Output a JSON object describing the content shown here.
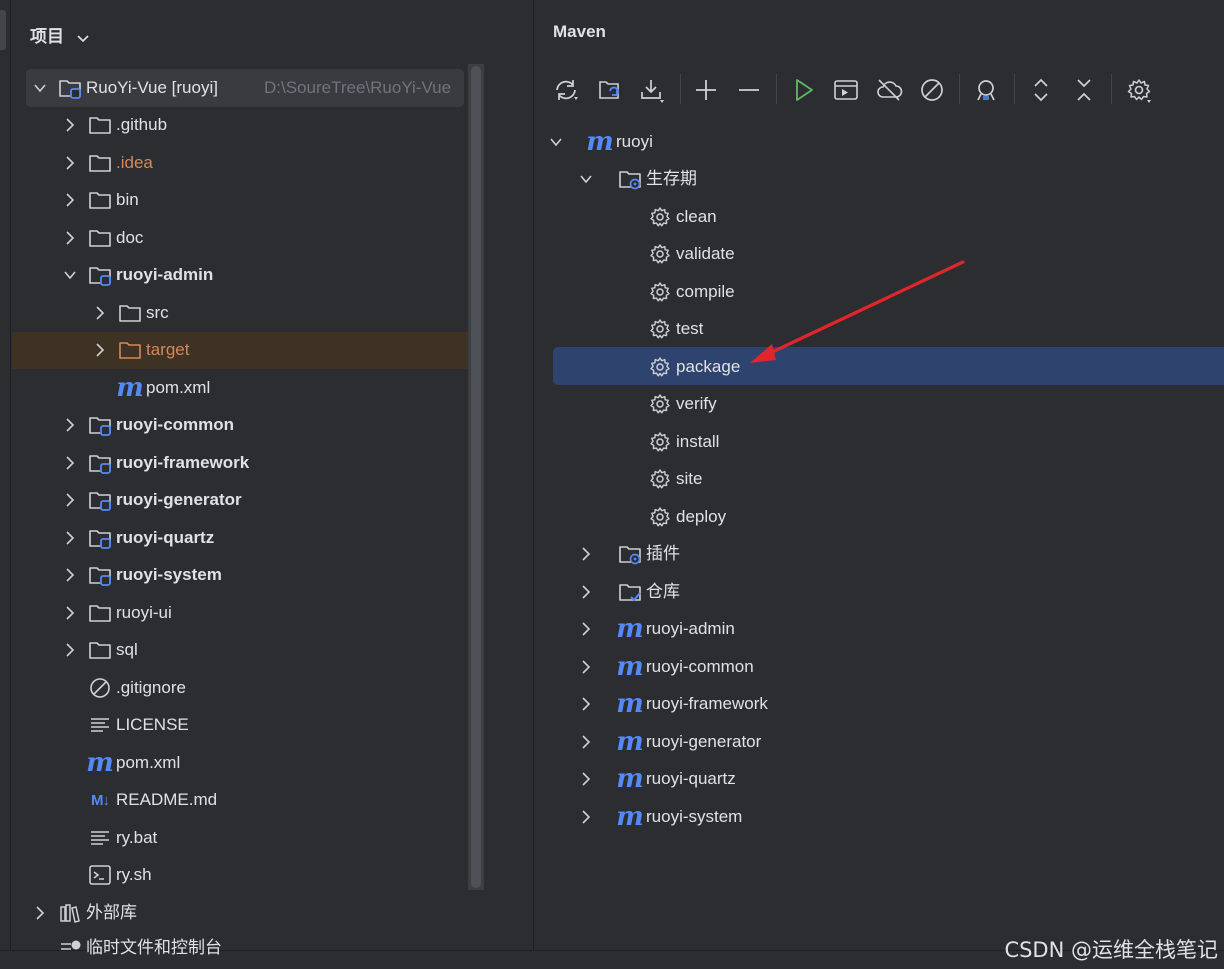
{
  "project": {
    "header": "项目",
    "items": [
      {
        "label": "RuoYi-Vue [ruoyi]",
        "path": "D:\\SoureTree\\RuoYi-Vue"
      },
      {
        "label": ".github"
      },
      {
        "label": ".idea"
      },
      {
        "label": "bin"
      },
      {
        "label": "doc"
      },
      {
        "label": "ruoyi-admin"
      },
      {
        "label": "src"
      },
      {
        "label": "target"
      },
      {
        "label": "pom.xml"
      },
      {
        "label": "ruoyi-common"
      },
      {
        "label": "ruoyi-framework"
      },
      {
        "label": "ruoyi-generator"
      },
      {
        "label": "ruoyi-quartz"
      },
      {
        "label": "ruoyi-system"
      },
      {
        "label": "ruoyi-ui"
      },
      {
        "label": "sql"
      },
      {
        "label": ".gitignore"
      },
      {
        "label": "LICENSE"
      },
      {
        "label": "pom.xml"
      },
      {
        "label": "README.md"
      },
      {
        "label": "ry.bat"
      },
      {
        "label": "ry.sh"
      },
      {
        "label": "外部库"
      },
      {
        "label": "临时文件和控制台"
      }
    ]
  },
  "maven": {
    "header": "Maven",
    "root": "ruoyi",
    "lifecycle": {
      "label": "生存期",
      "goals": [
        "clean",
        "validate",
        "compile",
        "test",
        "package",
        "verify",
        "install",
        "site",
        "deploy"
      ]
    },
    "plugins_label": "插件",
    "repos_label": "仓库",
    "modules": [
      "ruoyi-admin",
      "ruoyi-common",
      "ruoyi-framework",
      "ruoyi-generator",
      "ruoyi-quartz",
      "ruoyi-system"
    ],
    "selected_goal": "package"
  },
  "mvn_glyph": "m",
  "md_glyph": "M↓",
  "watermark": "CSDN @运维全栈笔记",
  "colors": {
    "accent_blue": "#548af7",
    "selection": "#2e436e",
    "excluded_orange": "#d5895a",
    "arrow_red": "#e0262b",
    "run_green": "#5fb865"
  }
}
